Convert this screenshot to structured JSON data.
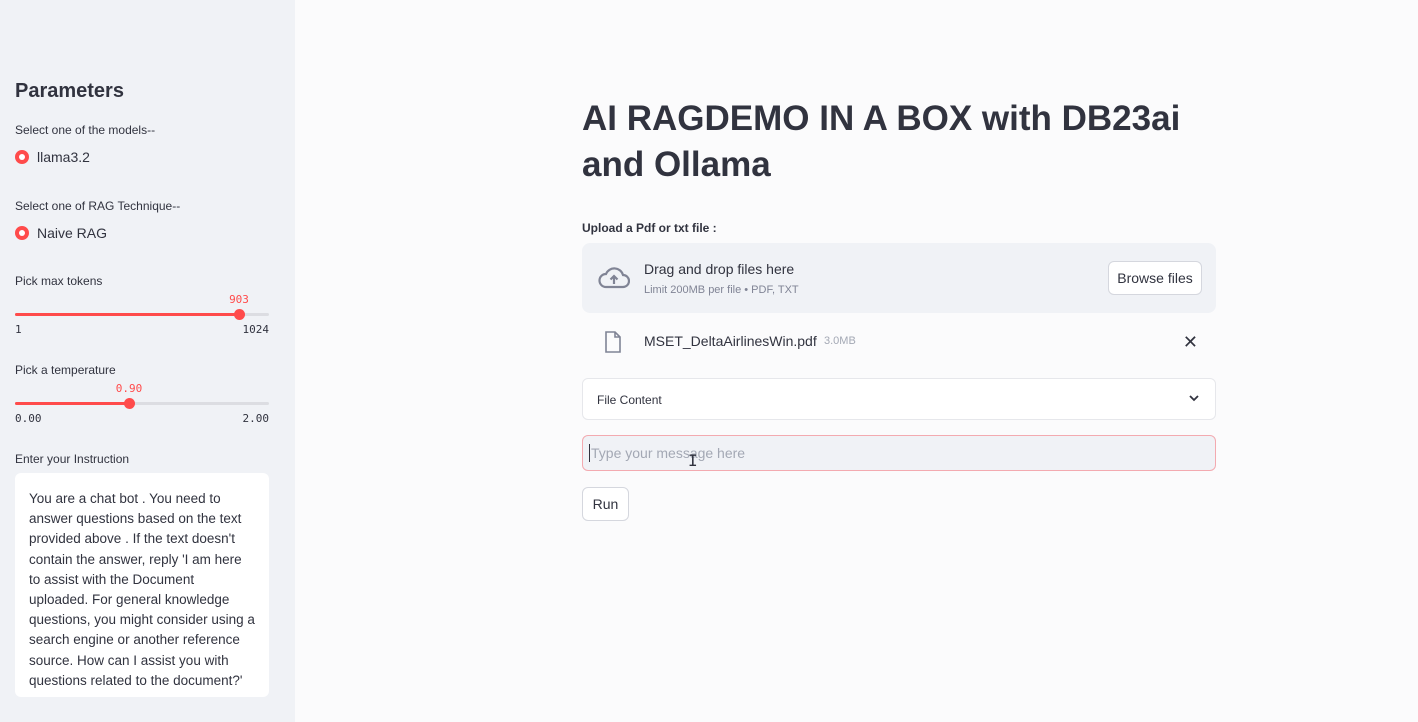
{
  "sidebar": {
    "title": "Parameters",
    "model_label": "Select one of the models--",
    "model_selected": "llama3.2",
    "rag_label": "Select one of RAG Technique--",
    "rag_selected": "Naive RAG",
    "max_tokens": {
      "label": "Pick max tokens",
      "value": "903",
      "min": "1",
      "max": "1024",
      "fraction": 0.882
    },
    "temperature": {
      "label": "Pick a temperature",
      "value": "0.90",
      "min": "0.00",
      "max": "2.00",
      "fraction": 0.45
    },
    "instruction_label": "Enter your Instruction",
    "instruction_text": "You are a chat bot . You need to answer questions based on the text provided above . If the text doesn't contain the answer, reply 'I am here to assist with the Document uploaded. For general knowledge questions, you might consider using a search engine or another reference source. How can I assist you with questions related to the document?'"
  },
  "main": {
    "title": "AI RAGDEMO IN A BOX with DB23ai and Ollama",
    "upload_label": "Upload a Pdf or txt file :",
    "dropzone_main": "Drag and drop files here",
    "dropzone_sub": "Limit 200MB per file • PDF, TXT",
    "browse_label": "Browse files",
    "file_name": "MSET_DeltaAirlinesWin.pdf",
    "file_size": "3.0MB",
    "expander_label": "File Content",
    "message_placeholder": "Type your message here",
    "run_label": "Run"
  },
  "colors": {
    "accent": "#ff4b4b",
    "sidebar_bg": "#f0f2f6"
  }
}
